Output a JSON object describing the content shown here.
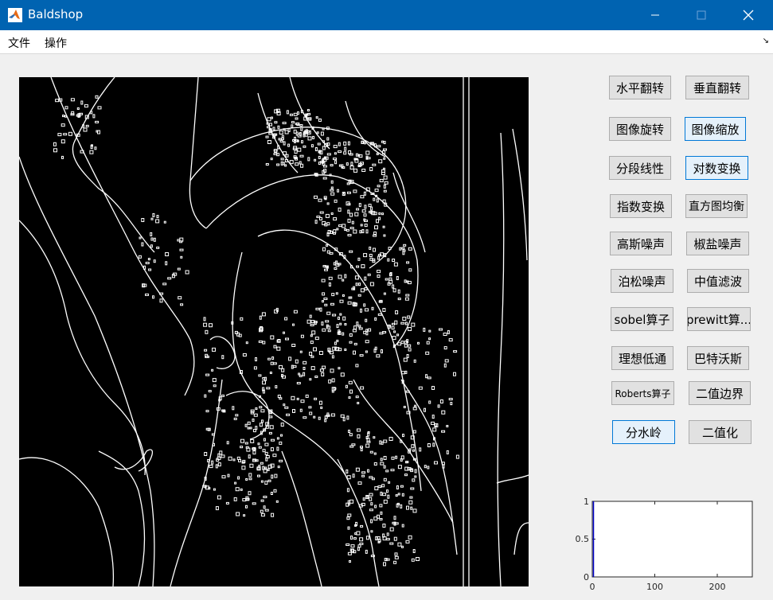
{
  "window": {
    "title": "Baldshop",
    "controls": {
      "minimize": "minimize",
      "maximize": "maximize",
      "close": "close"
    }
  },
  "menu": {
    "items": [
      {
        "label": "文件"
      },
      {
        "label": "操作"
      }
    ]
  },
  "buttons": [
    {
      "label": "水平翻转"
    },
    {
      "label": "垂直翻转"
    },
    {
      "label": "图像旋转"
    },
    {
      "label": "图像缩放"
    },
    {
      "label": "分段线性"
    },
    {
      "label": "对数变换"
    },
    {
      "label": "指数变换"
    },
    {
      "label": "直方图均衡"
    },
    {
      "label": "高斯噪声"
    },
    {
      "label": "椒盐噪声"
    },
    {
      "label": "泊松噪声"
    },
    {
      "label": "中值滤波"
    },
    {
      "label": "sobel算子"
    },
    {
      "label": "prewitt算..."
    },
    {
      "label": "理想低通"
    },
    {
      "label": "巴特沃斯"
    },
    {
      "label": "Roberts算子"
    },
    {
      "label": "二值边界"
    },
    {
      "label": "分水岭"
    },
    {
      "label": "二值化"
    }
  ],
  "histogram_axes": {
    "y_ticks": [
      "1",
      "0.5",
      "0"
    ],
    "x_ticks": [
      "0",
      "100",
      "200"
    ],
    "xlim": [
      0,
      256
    ],
    "ylim": [
      0,
      1
    ]
  },
  "colors": {
    "titlebar": "#0063b1",
    "image_background": "#000000",
    "edge_lines": "#ffffff",
    "focus_border": "#0078d7"
  }
}
